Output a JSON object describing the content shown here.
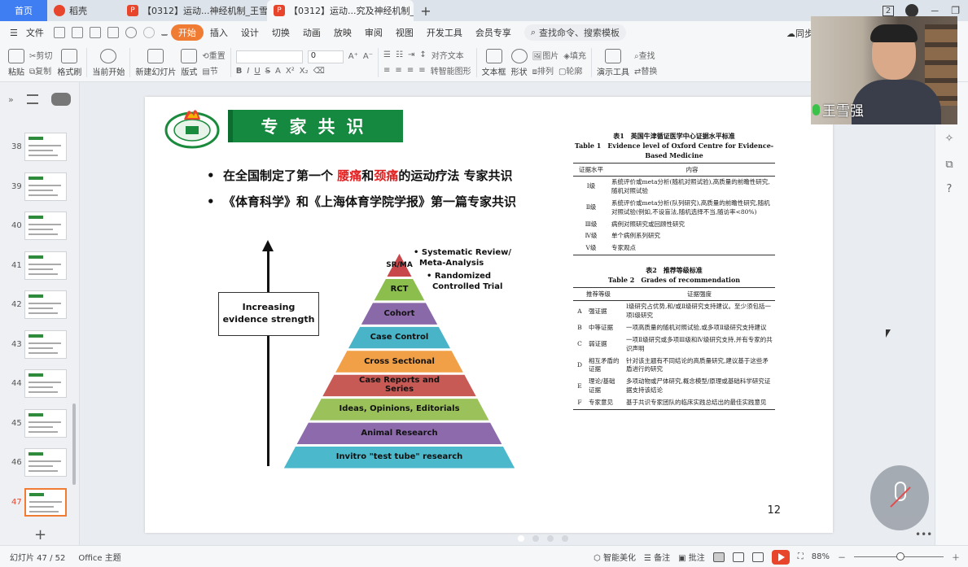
{
  "tabs": {
    "home": "首页",
    "docer": "稻壳",
    "file1": "【0312】运动...神经机制_王雪强",
    "file2": "【0312】运动...究及神经机制_2",
    "add": "+"
  },
  "window": {
    "badge": "2",
    "min": "－",
    "restore": "❐",
    "close": "✕"
  },
  "menu": {
    "hamburger": "☰",
    "file": "文件",
    "items": [
      "开始",
      "插入",
      "设计",
      "切换",
      "动画",
      "放映",
      "审阅",
      "视图",
      "开发工具",
      "会员专享"
    ],
    "search": "查找命令、搜索模板",
    "sync": "同步"
  },
  "ribbon": {
    "paste": "粘贴",
    "cut": "剪切",
    "copy": "复制",
    "format_painter": "格式刷",
    "from_current": "当前开始",
    "new_slide": "新建幻灯片",
    "layout": "版式",
    "section": "节",
    "reset": "重置",
    "font_size": "0",
    "text_box": "文本框",
    "shape": "形状",
    "arrange": "排列",
    "picture": "图片",
    "fill": "填充",
    "outline": "轮廓",
    "presenter": "演示工具",
    "find": "查找",
    "replace": "替换",
    "select": "选择",
    "align_text": "对齐文本",
    "to_smartart": "转智能图形"
  },
  "slides": {
    "numbers": [
      "38",
      "39",
      "40",
      "41",
      "42",
      "43",
      "44",
      "45",
      "46",
      "47"
    ],
    "current": "47"
  },
  "slide": {
    "title": "专家共识",
    "bullet1_pre": "在全国制定了第一个 ",
    "bullet1_red1": "腰痛",
    "bullet1_mid": "和",
    "bullet1_red2": "颈痛",
    "bullet1_post": "的运动疗法 专家共识",
    "bullet2": "《体育科学》和《上海体育学院学报》第一篇专家共识",
    "evidence_line1": "Increasing",
    "evidence_line2": "evidence strength",
    "pyramid": [
      {
        "label": "SR/MA",
        "color": "#c7474a"
      },
      {
        "label": "RCT",
        "color": "#8cbe4d"
      },
      {
        "label": "Cohort",
        "color": "#8a69a8"
      },
      {
        "label": "Case Control",
        "color": "#49b3c8"
      },
      {
        "label": "Cross Sectional",
        "color": "#f2a047"
      },
      {
        "label": "Case Reports and Series",
        "color": "#c85a55"
      },
      {
        "label": "Ideas, Opinions, Editorials",
        "color": "#9bc25a"
      },
      {
        "label": "Animal Research",
        "color": "#8c6aab"
      },
      {
        "label": "Invitro \"test tube\" research",
        "color": "#4cb8cc"
      }
    ],
    "callout1": "• Systematic Review/\n  Meta-Analysis",
    "callout2": "• Randomized\n  Controlled Trial",
    "table1": {
      "cap_cn": "表1　英国牛津循证医学中心证据水平标准",
      "cap_en": "Table 1　Evidence level of Oxford Centre for Evidence-Based Medicine",
      "headers": [
        "证据水平",
        "内容"
      ],
      "rows": [
        [
          "Ⅰ级",
          "系统评价或meta分析(随机对照试验),高质量的前瞻性研究,随机对照试验"
        ],
        [
          "Ⅱ级",
          "系统评价或meta分析(队列研究),高质量的前瞻性研究,随机对照试验(例如,不设盲法,随机选择不当,随访率<80%)"
        ],
        [
          "Ⅲ级",
          "病例对照研究或回顾性研究"
        ],
        [
          "Ⅳ级",
          "单个病例系列研究"
        ],
        [
          "Ⅴ级",
          "专家观点"
        ]
      ]
    },
    "table2": {
      "cap_cn": "表2　推荐等级标准",
      "cap_en": "Table 2　Grades of recommendation",
      "headers": [
        "推荐等级",
        "证据强度"
      ],
      "rows": [
        [
          "A",
          "强证据",
          "Ⅰ级研究占优势,和/或Ⅱ级研究支持建议。至少须包括一项Ⅰ级研究"
        ],
        [
          "B",
          "中等证据",
          "一项高质量的随机对照试验,或多项Ⅱ级研究支持建议"
        ],
        [
          "C",
          "弱证据",
          "一项Ⅱ级研究或多项Ⅲ级和Ⅳ级研究支持,并有专家的共识声明"
        ],
        [
          "D",
          "相互矛盾的证据",
          "针对该主题有不同结论的高质量研究,建议基于这些矛盾进行的研究"
        ],
        [
          "E",
          "理论/基础证据",
          "多项动物或尸体研究,概念模型/原理或基础科学研究证据支持该结论"
        ],
        [
          "F",
          "专家意见",
          "基于共识专家团队的临床实践总结出的最佳实践意见"
        ]
      ]
    },
    "page_number": "12"
  },
  "video": {
    "name": "王雪强"
  },
  "status": {
    "slide_info": "幻灯片 47 / 52",
    "theme": "Office 主题",
    "beautify": "智能美化",
    "notes": "备注",
    "comments": "批注",
    "zoom": "88%",
    "minus": "－",
    "plus": "＋"
  }
}
